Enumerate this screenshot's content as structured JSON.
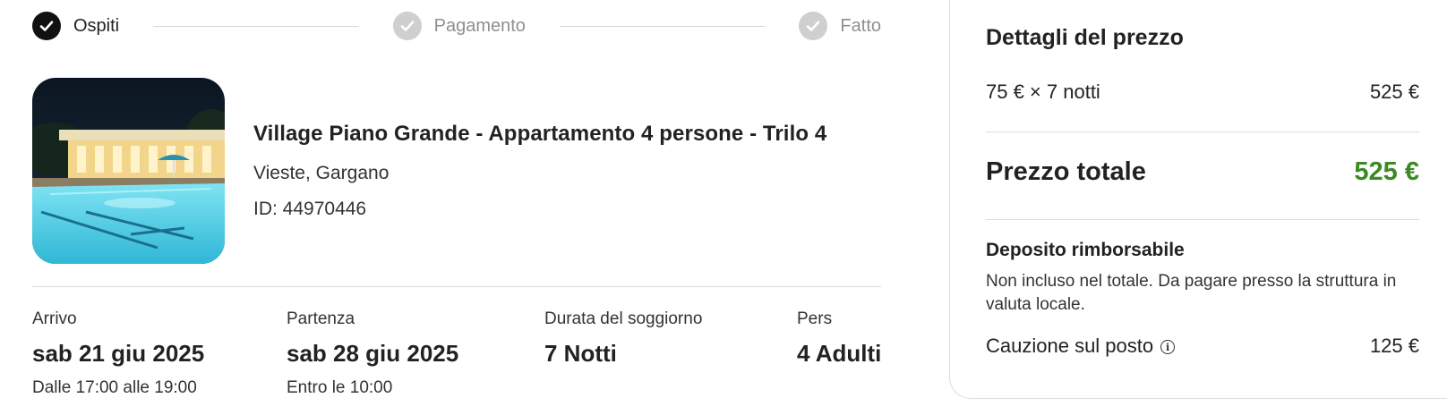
{
  "stepper": {
    "steps": [
      {
        "label": "Ospiti",
        "state": "done-active"
      },
      {
        "label": "Pagamento",
        "state": "inactive"
      },
      {
        "label": "Fatto",
        "state": "inactive"
      }
    ],
    "icon": "check-icon"
  },
  "listing": {
    "title": "Village Piano Grande - Appartamento 4 persone - Trilo 4",
    "location": "Vieste, Gargano",
    "id_text": "ID: 44970446",
    "image": "hotel-pool-night-photo"
  },
  "stay": {
    "arrival": {
      "label": "Arrivo",
      "value": "sab 21 giu 2025",
      "note": "Dalle 17:00 alle 19:00"
    },
    "departure": {
      "label": "Partenza",
      "value": "sab 28 giu 2025",
      "note": "Entro le 10:00"
    },
    "duration": {
      "label": "Durata del soggiorno",
      "value": "7 Notti"
    },
    "guests": {
      "label": "Pers",
      "value": "4 Adulti"
    }
  },
  "price": {
    "heading": "Dettagli del prezzo",
    "nights_label": "75 € × 7 notti",
    "nights_value": "525 €",
    "total_label": "Prezzo totale",
    "total_value": "525 €",
    "deposit_title": "Deposito rimborsabile",
    "deposit_desc": "Non incluso nel totale. Da pagare presso la struttura in valuta locale.",
    "caution_label": "Cauzione sul posto",
    "caution_value": "125 €",
    "info_icon": "info-icon"
  },
  "colors": {
    "accent_total": "#3b8a24",
    "step_active": "#111111",
    "step_inactive": "#cfcfcf"
  }
}
